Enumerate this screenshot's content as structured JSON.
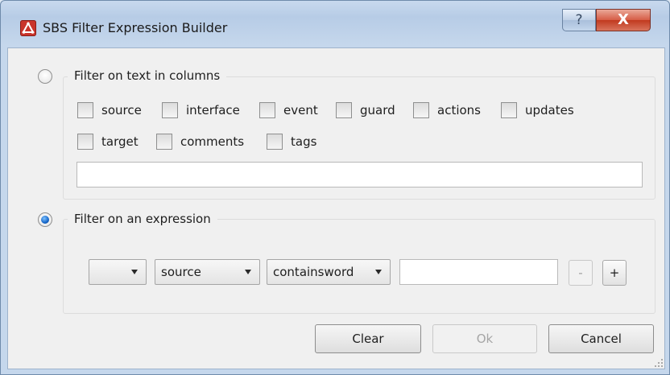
{
  "window": {
    "title": "SBS Filter Expression Builder",
    "help_glyph": "?",
    "close_glyph": "X"
  },
  "text_filter": {
    "label": "Filter on text in columns",
    "selected": false,
    "columns": [
      {
        "label": "source",
        "checked": false
      },
      {
        "label": "interface",
        "checked": false
      },
      {
        "label": "event",
        "checked": false
      },
      {
        "label": "guard",
        "checked": false
      },
      {
        "label": "actions",
        "checked": false
      },
      {
        "label": "updates",
        "checked": false
      },
      {
        "label": "target",
        "checked": false
      },
      {
        "label": "comments",
        "checked": false
      },
      {
        "label": "tags",
        "checked": false
      }
    ],
    "text_value": ""
  },
  "expression_filter": {
    "label": "Filter on an expression",
    "selected": true,
    "prefix_value": "",
    "column_value": "source",
    "operator_value": "containsword",
    "value_text": "",
    "remove_label": "-",
    "add_label": "+"
  },
  "buttons": {
    "clear": "Clear",
    "ok": "Ok",
    "cancel": "Cancel"
  },
  "colors": {
    "selected_radio": "#1565c8",
    "close_button": "#c1391f"
  }
}
